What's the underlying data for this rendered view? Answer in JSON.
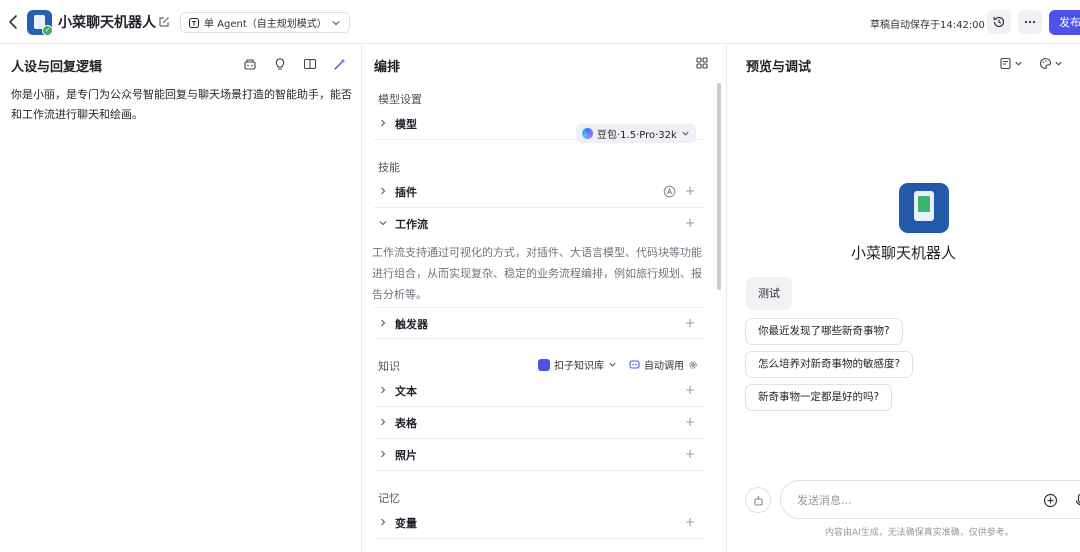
{
  "topbar": {
    "app_title": "小菜聊天机器人",
    "mode_label": "单 Agent（自主规划模式）",
    "autosave_text": "草稿自动保存于14:42:00",
    "publish_label": "发布"
  },
  "left": {
    "title": "人设与回复逻辑",
    "persona_text": "你是小丽，是专门为公众号智能回复与聊天场景打造的智能助手，能否和工作流进行聊天和绘画。"
  },
  "middle": {
    "title": "编排",
    "model_section": "模型设置",
    "model_label": "模型",
    "model_value": "豆包·1.5·Pro·32k",
    "skills_section": "技能",
    "plugins_label": "插件",
    "workflow_label": "工作流",
    "workflow_desc": "工作流支持通过可视化的方式，对插件、大语言模型、代码块等功能进行组合，从而实现复杂、稳定的业务流程编排，例如旅行规划、报告分析等。",
    "triggers_label": "触发器",
    "knowledge_section": "知识",
    "kb_source": "扣子知识库",
    "kb_mode": "自动调用",
    "text_label": "文本",
    "table_label": "表格",
    "photo_label": "照片",
    "memory_section": "记忆",
    "variables_label": "变量"
  },
  "right": {
    "title": "预览与调试",
    "bot_name": "小菜聊天机器人",
    "user_message": "测试",
    "suggestions": [
      "你最近发现了哪些新奇事物?",
      "怎么培养对新奇事物的敏感度?",
      "新奇事物一定都是好的吗?"
    ],
    "input_placeholder": "发送消息...",
    "disclaimer": "内容由AI生成，无法确保真实准确，仅供参考。"
  },
  "colors": {
    "accent": "#4d53e8",
    "avatar_bg": "#2458a8",
    "badge_green": "#2fb35a"
  }
}
